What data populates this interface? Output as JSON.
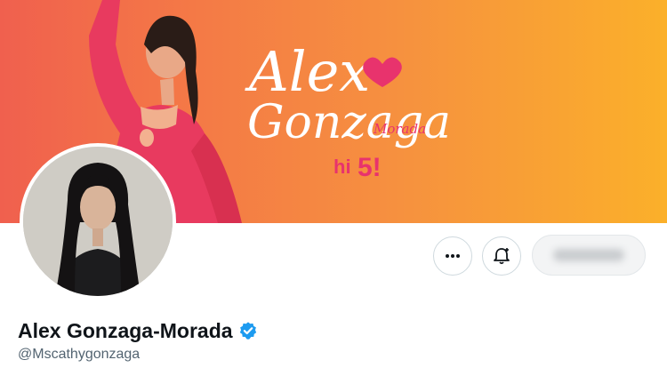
{
  "profile": {
    "display_name": "Alex Gonzaga-Morada",
    "handle": "@Mscathygonzaga",
    "verified": true
  },
  "banner": {
    "title_line1": "Alex",
    "title_line2": "Gonzaga",
    "title_sub": "Morada",
    "tagline_hi": "hi",
    "tagline_num": "5!",
    "accent_color": "#e8336d"
  },
  "actions": {
    "more_icon": "more-dots-icon",
    "notify_icon": "bell-plus-icon",
    "follow_label": ""
  },
  "colors": {
    "verified_badge": "#1d9bf0",
    "banner_left": "#f0604e",
    "banner_right": "#fbb02a"
  }
}
